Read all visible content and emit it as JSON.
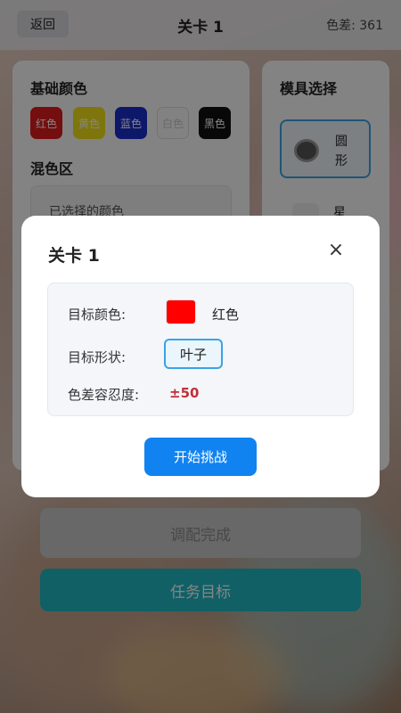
{
  "header": {
    "back_label": "返回",
    "title": "关卡 1",
    "delta_text": "色差: 361"
  },
  "left_panel": {
    "title": "基础颜色",
    "colors": [
      {
        "label": "红色",
        "hex": "#e01c1c",
        "text_color": "#ffffff"
      },
      {
        "label": "黄色",
        "hex": "#f2e21a",
        "text_color": "#ffffff"
      },
      {
        "label": "蓝色",
        "hex": "#1b2fcc",
        "text_color": "#ffffff"
      },
      {
        "label": "白色",
        "hex": "#fafafa",
        "text_color": "#c9c9c9"
      },
      {
        "label": "黑色",
        "hex": "#111111",
        "text_color": "#ffffff"
      }
    ],
    "mix_title": "混色区",
    "selected_label": "已选择的颜色"
  },
  "right_panel": {
    "title": "模具选择",
    "molds": [
      {
        "label": "圆形"
      },
      {
        "label": "星"
      }
    ]
  },
  "bottom": {
    "complete_label": "调配完成",
    "task_label": "任务目标"
  },
  "modal": {
    "title": "关卡 1",
    "close_glyph": "×",
    "target_color_label": "目标颜色:",
    "target_color_name": "红色",
    "target_color_hex": "#ff0000",
    "target_shape_label": "目标形状:",
    "target_shape_value": "叶子",
    "tolerance_label": "色差容忍度:",
    "tolerance_value": "±50",
    "start_label": "开始挑战"
  }
}
